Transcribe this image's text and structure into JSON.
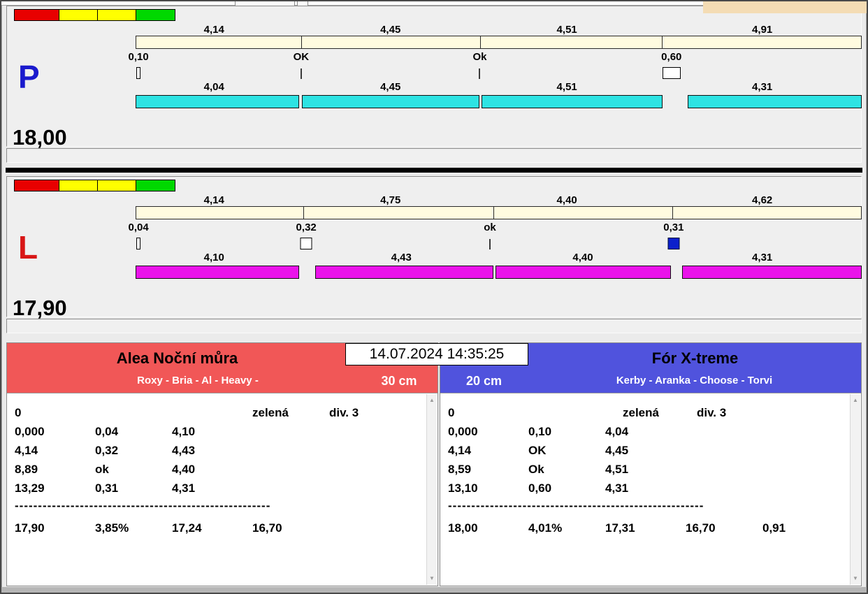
{
  "timestamp": "14.07.2024 14:35:25",
  "panels": [
    {
      "letter": "P",
      "total": "18,00",
      "upper_values": [
        "4,14",
        "4,45",
        "4,51",
        "4,91"
      ],
      "markers": [
        "0,10",
        "OK",
        "Ok",
        "0,60"
      ],
      "lower_values": [
        "4,04",
        "4,45",
        "4,51",
        "4,31"
      ]
    },
    {
      "letter": "L",
      "total": "17,90",
      "upper_values": [
        "4,14",
        "4,75",
        "4,40",
        "4,62"
      ],
      "markers": [
        "0,04",
        "0,32",
        "ok",
        "0,31"
      ],
      "lower_values": [
        "4,10",
        "4,43",
        "4,40",
        "4,31"
      ]
    }
  ],
  "teams": [
    {
      "name": "Alea Noční můra",
      "members": "Roxy - Bria - Al - Heavy -",
      "category": "30 cm",
      "first_row": {
        "count": "0",
        "color": "zelená",
        "division": "div. 3"
      },
      "splits": [
        [
          "0,000",
          "0,04",
          "4,10"
        ],
        [
          "4,14",
          "0,32",
          "4,43"
        ],
        [
          "8,89",
          "ok",
          "4,40"
        ],
        [
          "13,29",
          "0,31",
          "4,31"
        ]
      ],
      "separator": "-------------------------------------------------------",
      "summary": [
        "17,90",
        "3,85%",
        "17,24",
        "16,70"
      ]
    },
    {
      "name": "Fór X-treme",
      "members": "Kerby - Aranka - Choose - Torvi",
      "category": "20 cm",
      "first_row": {
        "count": "0",
        "color": "zelená",
        "division": "div. 3"
      },
      "splits": [
        [
          "0,000",
          "0,10",
          "4,04"
        ],
        [
          "4,14",
          "OK",
          "4,45"
        ],
        [
          "8,59",
          "Ok",
          "4,51"
        ],
        [
          "13,10",
          "0,60",
          "4,31"
        ]
      ],
      "separator": "-------------------------------------------------------",
      "summary": [
        "18,00",
        "4,01%",
        "17,31",
        "16,70",
        "0,91"
      ]
    }
  ],
  "colors": {
    "p_letter": "#1a1acd",
    "l_letter": "#d81616",
    "upper_bar": "#fffbe0",
    "p_lower_bar": "#2ee3e3",
    "l_lower_bar": "#ea13ea",
    "left_header": "#f15757",
    "right_header": "#5053dd",
    "blue_marker": "#0b20cc",
    "traffic_lights": [
      "#e80000",
      "#ffff00",
      "#ffff00",
      "#00d800"
    ]
  },
  "icons": {
    "scroll_up": "▲",
    "scroll_down": "▼"
  }
}
